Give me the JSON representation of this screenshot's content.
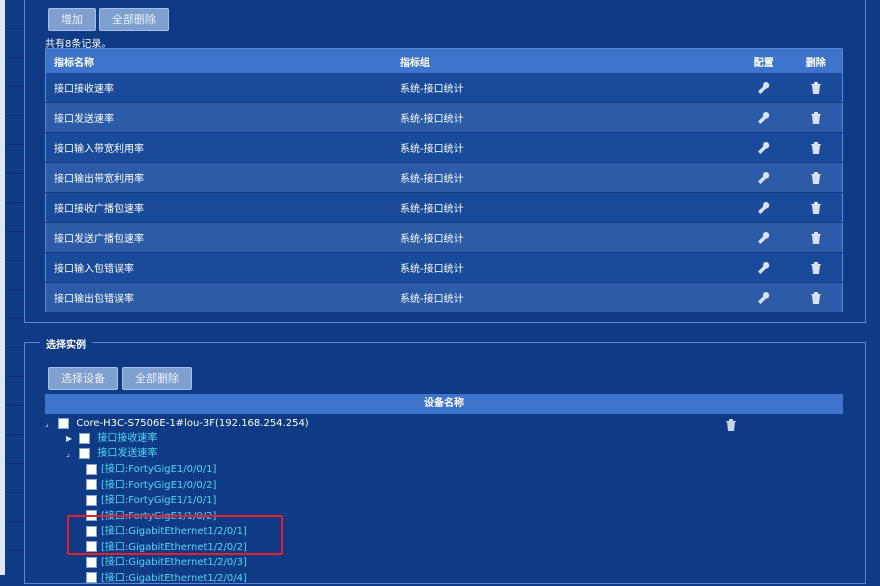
{
  "toolbar": {
    "add_label": "增加",
    "delete_all_label": "全部删除"
  },
  "records_text": "共有8条记录。",
  "table": {
    "headers": {
      "name": "指标名称",
      "group": "指标组",
      "config": "配置",
      "delete": "删除"
    },
    "rows": [
      {
        "name": "接口接收速率",
        "group": "系统-接口统计"
      },
      {
        "name": "接口发送速率",
        "group": "系统-接口统计"
      },
      {
        "name": "接口输入带宽利用率",
        "group": "系统-接口统计"
      },
      {
        "name": "接口输出带宽利用率",
        "group": "系统-接口统计"
      },
      {
        "name": "接口接收广播包速率",
        "group": "系统-接口统计"
      },
      {
        "name": "接口发送广播包速率",
        "group": "系统-接口统计"
      },
      {
        "name": "接口输入包错误率",
        "group": "系统-接口统计"
      },
      {
        "name": "接口输出包错误率",
        "group": "系统-接口统计"
      }
    ]
  },
  "instance": {
    "section_title": "选择实例",
    "select_device_label": "选择设备",
    "delete_all_label": "全部删除",
    "tree_header": "设备名称",
    "tree": {
      "device": "Core-H3C-S7506E-1#lou-3F(192.168.254.254)",
      "metric_1": "接口接收速率",
      "metric_2": "接口发送速率",
      "ports": [
        "[接口:FortyGigE1/0/0/1]",
        "[接口:FortyGigE1/0/0/2]",
        "[接口:FortyGigE1/1/0/1]",
        "[接口:FortyGigE1/1/0/2]",
        "[接口:GigabitEthernet1/2/0/1]",
        "[接口:GigabitEthernet1/2/0/2]",
        "[接口:GigabitEthernet1/2/0/3]",
        "[接口:GigabitEthernet1/2/0/4]"
      ]
    }
  },
  "colors": {
    "background": "#0f3a86",
    "header": "#3f74cc",
    "link": "#4fd8f5",
    "highlight": "#e51f2b"
  }
}
